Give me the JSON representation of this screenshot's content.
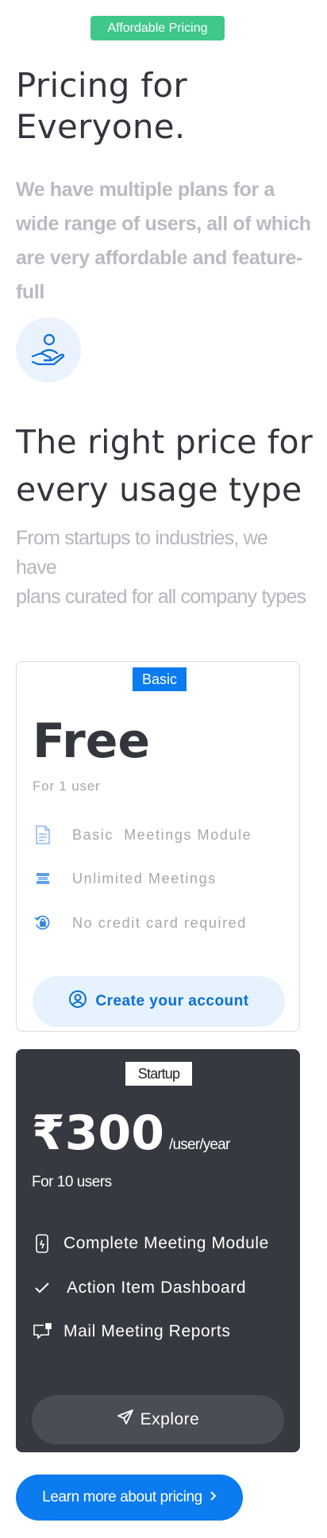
{
  "hero": {
    "badge": "Affordable Pricing",
    "title_line1": "Pricing for",
    "title_line2": "Everyone.",
    "description": "We have multiple plans for a wide range of users, all of which are very affordable and feature-full",
    "icon": "hand-user-icon"
  },
  "section": {
    "title_line1": "The right price for",
    "title_line2": "every usage type",
    "desc_line1": "From startups to industries, we have",
    "desc_line2": "plans curated for all company types"
  },
  "plans": [
    {
      "tag": "Basic",
      "price": "Free",
      "users": "For 1 user",
      "features": [
        {
          "icon": "document-icon",
          "label": "Basic  Meetings Module"
        },
        {
          "icon": "stack-icon",
          "label": "Unlimited Meetings"
        },
        {
          "icon": "lock-refresh-icon",
          "label": "No credit card required"
        }
      ],
      "cta": "Create your account",
      "cta_icon": "user-circle-icon"
    },
    {
      "tag": "Startup",
      "price": "₹300",
      "price_unit": "/user/year",
      "users": "For 10 users",
      "features": [
        {
          "icon": "mobile-icon",
          "label": "Complete Meeting Module"
        },
        {
          "icon": "check-icon",
          "label": "Action Item Dashboard"
        },
        {
          "icon": "mail-report-icon",
          "label": "Mail Meeting Reports"
        }
      ],
      "cta": "Explore",
      "cta_icon": "send-icon"
    }
  ],
  "learn_more": {
    "label": "Learn more about pricing",
    "icon": "chevron-right-icon"
  },
  "colors": {
    "accent": "#0b7bef",
    "badge_green": "#3fc88a",
    "dark_card": "#36393f"
  }
}
